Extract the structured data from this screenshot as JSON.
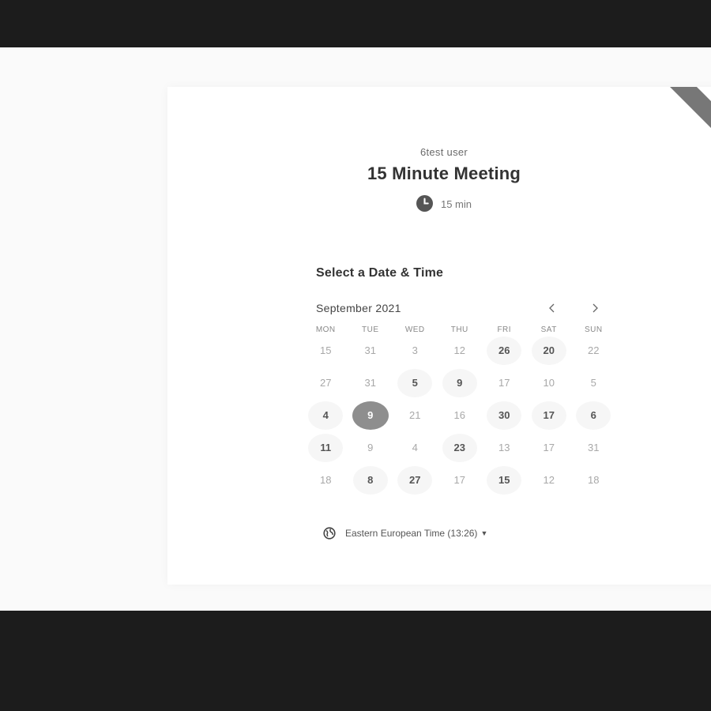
{
  "event": {
    "owner": "6test user",
    "title": "15 Minute Meeting",
    "duration": "15 min"
  },
  "picker": {
    "heading": "Select a Date & Time",
    "month": "September 2021",
    "prev_icon": "chevron-left-icon",
    "next_icon": "chevron-right-icon",
    "weekdays": [
      "MON",
      "TUE",
      "WED",
      "THU",
      "FRI",
      "SAT",
      "SUN"
    ],
    "weeks": [
      [
        {
          "d": "15",
          "a": false
        },
        {
          "d": "31",
          "a": false
        },
        {
          "d": "3",
          "a": false
        },
        {
          "d": "12",
          "a": false
        },
        {
          "d": "26",
          "a": true
        },
        {
          "d": "20",
          "a": true
        },
        {
          "d": "22",
          "a": false
        }
      ],
      [
        {
          "d": "27",
          "a": false
        },
        {
          "d": "31",
          "a": false
        },
        {
          "d": "5",
          "a": true
        },
        {
          "d": "9",
          "a": true
        },
        {
          "d": "17",
          "a": false
        },
        {
          "d": "10",
          "a": false
        },
        {
          "d": "5",
          "a": false
        }
      ],
      [
        {
          "d": "4",
          "a": true
        },
        {
          "d": "9",
          "a": true,
          "selected": true
        },
        {
          "d": "21",
          "a": false
        },
        {
          "d": "16",
          "a": false
        },
        {
          "d": "30",
          "a": true
        },
        {
          "d": "17",
          "a": true
        },
        {
          "d": "6",
          "a": true
        }
      ],
      [
        {
          "d": "11",
          "a": true
        },
        {
          "d": "9",
          "a": false
        },
        {
          "d": "4",
          "a": false
        },
        {
          "d": "23",
          "a": true
        },
        {
          "d": "13",
          "a": false
        },
        {
          "d": "17",
          "a": false
        },
        {
          "d": "31",
          "a": false
        }
      ],
      [
        {
          "d": "18",
          "a": false
        },
        {
          "d": "8",
          "a": true
        },
        {
          "d": "27",
          "a": true
        },
        {
          "d": "17",
          "a": false
        },
        {
          "d": "15",
          "a": true
        },
        {
          "d": "12",
          "a": false
        },
        {
          "d": "18",
          "a": false
        }
      ]
    ],
    "timezone": "Eastern European Time (13:26)"
  },
  "icons": {
    "clock": "clock-icon",
    "globe": "globe-icon"
  },
  "colors": {
    "selected": "#8e8e8e",
    "ribbon": "#777777"
  }
}
